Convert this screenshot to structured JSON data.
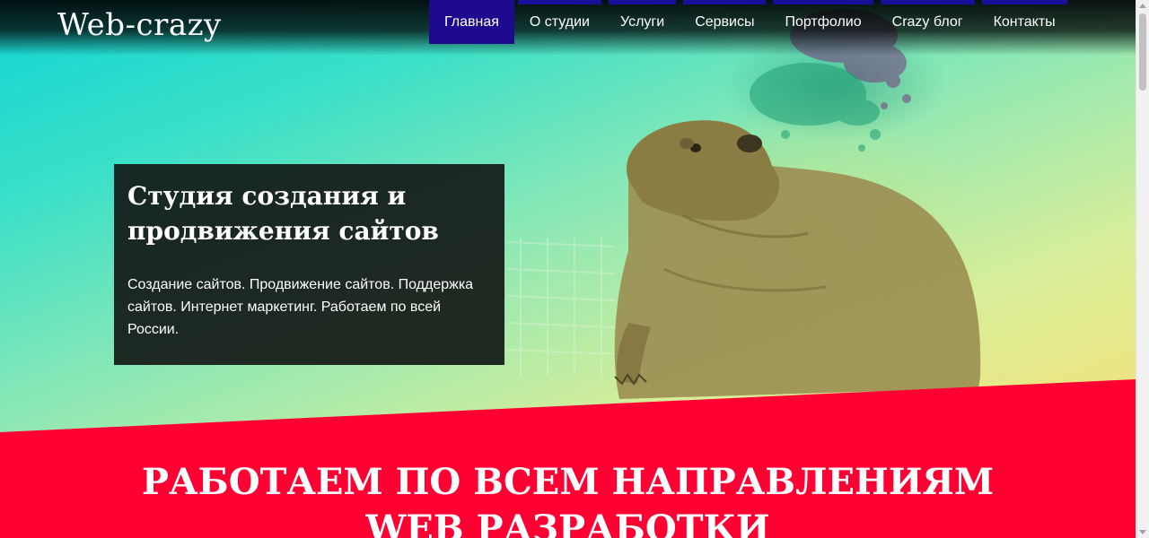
{
  "site": {
    "logo": "Web-crazy"
  },
  "nav": {
    "items": [
      {
        "label": "Главная",
        "active": true
      },
      {
        "label": "О студии"
      },
      {
        "label": "Услуги"
      },
      {
        "label": "Сервисы"
      },
      {
        "label": "Портфолио"
      },
      {
        "label": "Crazy блог"
      },
      {
        "label": "Контакты"
      }
    ]
  },
  "hero": {
    "title": "Студия создания и продвижения сайтов",
    "description": "Создание сайтов. Продвижение сайтов. Поддержка сайтов. Интернет маркетинг. Работаем по всей России.",
    "image": "beaver-photo"
  },
  "services_section": {
    "title": "Работаем по всем направлениям WEB разработки"
  },
  "colors": {
    "nav_active": "#1d0a8f",
    "nav_accent": "#1a0f9a",
    "section_red": "#ff0033",
    "hero_gradient_start": "#12d4d4",
    "hero_gradient_end": "#f5dc6a",
    "card_bg": "#14181a"
  }
}
